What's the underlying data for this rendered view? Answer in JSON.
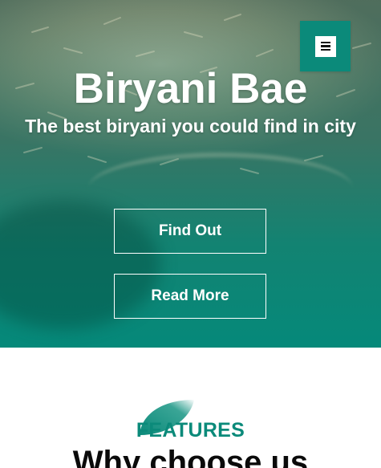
{
  "hero": {
    "title": "Biryani Bae",
    "subtitle": "The best biryani you could find in city",
    "buttons": {
      "find_out": "Find Out",
      "read_more": "Read More"
    }
  },
  "nav": {
    "menu_icon": "hamburger-menu-icon"
  },
  "features": {
    "label": "FEATURES",
    "heading": "Why choose us"
  },
  "colors": {
    "accent": "#0b8a7a",
    "hero_overlay_bottom": "#05897a",
    "text_light": "#ffffff",
    "heading_dark": "#0a0a0a"
  }
}
